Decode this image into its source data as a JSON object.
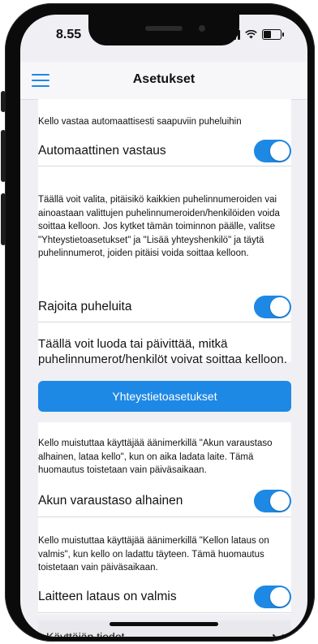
{
  "status_bar": {
    "time": "8.55"
  },
  "header": {
    "title": "Asetukset"
  },
  "sections": [
    {
      "description": "Kello vastaa automaattisesti saapuviin puheluihin",
      "toggle_label": "Automaattinen vastaus",
      "toggle_on": true
    },
    {
      "description": "Täällä voit valita, pitäisikö kaikkien puhelinnumeroiden vai ainoastaan valittujen puhelinnumeroiden/henkilöiden voida soittaa kelloon. Jos kytket tämän toiminnon päälle, valitse \"Yhteystietoasetukset\" ja \"Lisää yhteyshenkilö\" ja täytä puhelinnumerot, joiden pitäisi voida soittaa kelloon.",
      "toggle_label": "Rajoita puheluita",
      "toggle_on": true
    },
    {
      "description": "Täällä voit luoda tai päivittää, mitkä puhelinnumerot/henkilöt voivat soittaa kelloon.",
      "button_label": "Yhteystietoasetukset"
    },
    {
      "description": "Kello muistuttaa käyttäjää äänimerkillä \"Akun varaustaso alhainen, lataa kello\", kun on aika ladata laite. Tämä huomautus toistetaan vain päiväsaikaan.",
      "toggle_label": "Akun varaustaso alhainen",
      "toggle_on": true
    },
    {
      "description": "Kello muistuttaa käyttäjää äänimerkillä \"Kellon lataus on valmis\", kun kello on ladattu täyteen. Tämä huomautus toistetaan vain päiväsaikaan.",
      "toggle_label": "Laitteen lataus on valmis",
      "toggle_on": true
    }
  ],
  "collapsed_section": {
    "label": "Käyttäjän tiedot"
  },
  "colors": {
    "accent": "#1e88e5",
    "background": "#efeff4"
  }
}
